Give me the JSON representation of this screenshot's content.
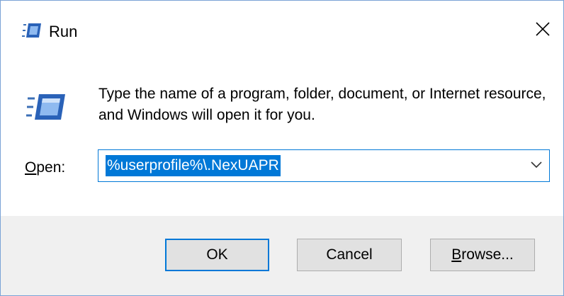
{
  "window": {
    "title": "Run",
    "close_glyph": "✕"
  },
  "body": {
    "description": "Type the name of a program, folder, document, or Internet resource, and Windows will open it for you.",
    "open_label_accel": "O",
    "open_label_rest": "pen:",
    "input_value": "%userprofile%\\.NexUAPR"
  },
  "buttons": {
    "ok": "OK",
    "cancel": "Cancel",
    "browse_accel": "B",
    "browse_rest": "rowse..."
  },
  "colors": {
    "accent": "#0078d7",
    "footer_bg": "#f0f0f0",
    "button_bg": "#e1e1e1"
  },
  "icons": {
    "title": "run-icon",
    "body": "run-icon",
    "close": "close-icon",
    "dropdown": "chevron-down-icon"
  }
}
